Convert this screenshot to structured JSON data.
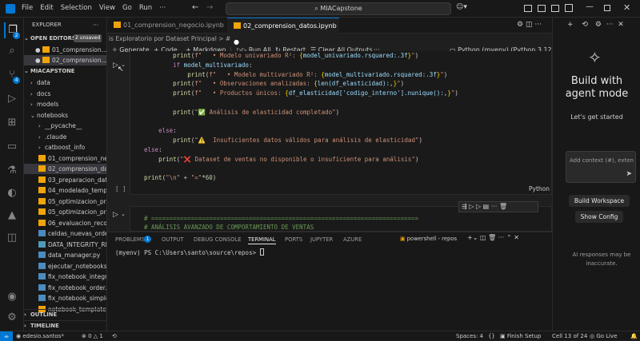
{
  "titlebar": {
    "menus": [
      "File",
      "Edit",
      "Selection",
      "View",
      "Go",
      "Run"
    ],
    "more": "···",
    "search": "MIACapstone"
  },
  "activity": {
    "explorer_badge": "2",
    "scm_badge": "4"
  },
  "sidebar": {
    "title": "EXPLORER",
    "more": "···",
    "open_editors": "OPEN EDITORS",
    "unsaved": "2 unsaved",
    "open_files": [
      "01_comprension...",
      "02_comprension..."
    ],
    "project": "MIACAPSTONE",
    "tree": [
      {
        "label": "data",
        "type": "folder",
        "depth": 1
      },
      {
        "label": "docs",
        "type": "folder",
        "depth": 1
      },
      {
        "label": "models",
        "type": "folder",
        "depth": 1
      },
      {
        "label": "notebooks",
        "type": "folder-open",
        "depth": 1
      },
      {
        "label": "__pycache__",
        "type": "folder",
        "depth": 2
      },
      {
        "label": ".claude",
        "type": "folder",
        "depth": 2
      },
      {
        "label": "catboost_info",
        "type": "folder",
        "depth": 2
      },
      {
        "label": "01_comprension_ne...",
        "type": "nb",
        "depth": 2
      },
      {
        "label": "02_comprension_da...",
        "type": "nb",
        "depth": 2,
        "selected": true
      },
      {
        "label": "03_preparacion_dat...",
        "type": "nb",
        "depth": 2
      },
      {
        "label": "04_modelado_temp...",
        "type": "nb",
        "depth": 2
      },
      {
        "label": "05_optimizacion_pr...",
        "type": "nb",
        "depth": 2
      },
      {
        "label": "05_optimizacion_pr...",
        "type": "nb",
        "depth": 2
      },
      {
        "label": "06_evaluacion_reco...",
        "type": "nb",
        "depth": 2
      },
      {
        "label": "celdas_nuevas_orde...",
        "type": "py",
        "depth": 2
      },
      {
        "label": "DATA_INTEGRITY_RE...",
        "type": "md",
        "depth": 2
      },
      {
        "label": "data_manager.py",
        "type": "py",
        "depth": 2
      },
      {
        "label": "ejecutar_notebooks...",
        "type": "py",
        "depth": 2
      },
      {
        "label": "fix_notebook_integri...",
        "type": "py",
        "depth": 2
      },
      {
        "label": "fix_notebook_order...",
        "type": "py",
        "depth": 2
      },
      {
        "label": "fix_notebook_simple...",
        "type": "py",
        "depth": 2
      },
      {
        "label": "notebook_template...",
        "type": "nb",
        "depth": 2
      }
    ],
    "outline": "OUTLINE",
    "timeline": "TIMELINE"
  },
  "tabs": [
    {
      "label": "01_comprension_negocio.ipynb"
    },
    {
      "label": "02_comprension_datos.ipynb",
      "modified": "●"
    }
  ],
  "breadcrumb": "is Exploratorio por Dataset Principal  > #",
  "toolbar": {
    "generate": "Generate",
    "code": "+ Code",
    "markdown": "+ Markdown",
    "run_all": "Run All",
    "restart": "Restart",
    "clear": "Clear All Outputs",
    "kernel": "Python (myenv) (Python 3.12.10)"
  },
  "code_lines": [
    "        print(f\"   • Modelo univariado R²: {model_univariado.rsquared:.3f}\")",
    "        if model_multivariado:",
    "            print(f\"   • Modelo multivariado R²: {model_multivariado.rsquared:.3f}\")",
    "        print(f\"   • Observaciones analizadas: {len(df_elasticidad):,}\")",
    "        print(f\"   • Productos únicos: {df_elasticidad['codigo_interno'].nunique():,}\")",
    "",
    "        print(\"✅ Análisis de elasticidad completado\")",
    "",
    "    else:",
    "        print(\"⚠️  Insuficientes datos válidos para análisis de elasticidad\")",
    "else:",
    "    print(\"❌ Dataset de ventas no disponible o insuficiente para análisis\")",
    "",
    "print(\"\\n\" + \"=\"*60)"
  ],
  "cell1_footer": {
    "brackets": "[ ]",
    "lang": "Python"
  },
  "cell2_lines": [
    "# ==========================================================================",
    "# ANÁLISIS AVANZADO DE COMPORTAMIENTO DE VENTAS"
  ],
  "panel": {
    "tabs": [
      "PROBLEMS",
      "OUTPUT",
      "DEBUG CONSOLE",
      "TERMINAL",
      "PORTS",
      "JUPYTER",
      "AZURE"
    ],
    "problems_badge": "1",
    "shell": "powershell - repos",
    "prompt": "(myenv) PS C:\\Users\\santo\\source\\repos> "
  },
  "chat": {
    "title": "Build with agent mode",
    "subtitle": "Let's get started",
    "input_placeholder": "Add context (#), exten",
    "btn_workspace": "Build Workspace",
    "btn_config": "Show Config",
    "disclaimer": "AI responses may be inaccurate."
  },
  "status": {
    "account": "edesio.santos*",
    "errors": "0",
    "warnings": "1",
    "spaces": "Spaces: 4",
    "finish": "Finish Setup",
    "cell": "Cell 13 of 24",
    "golive": "Go Live"
  }
}
